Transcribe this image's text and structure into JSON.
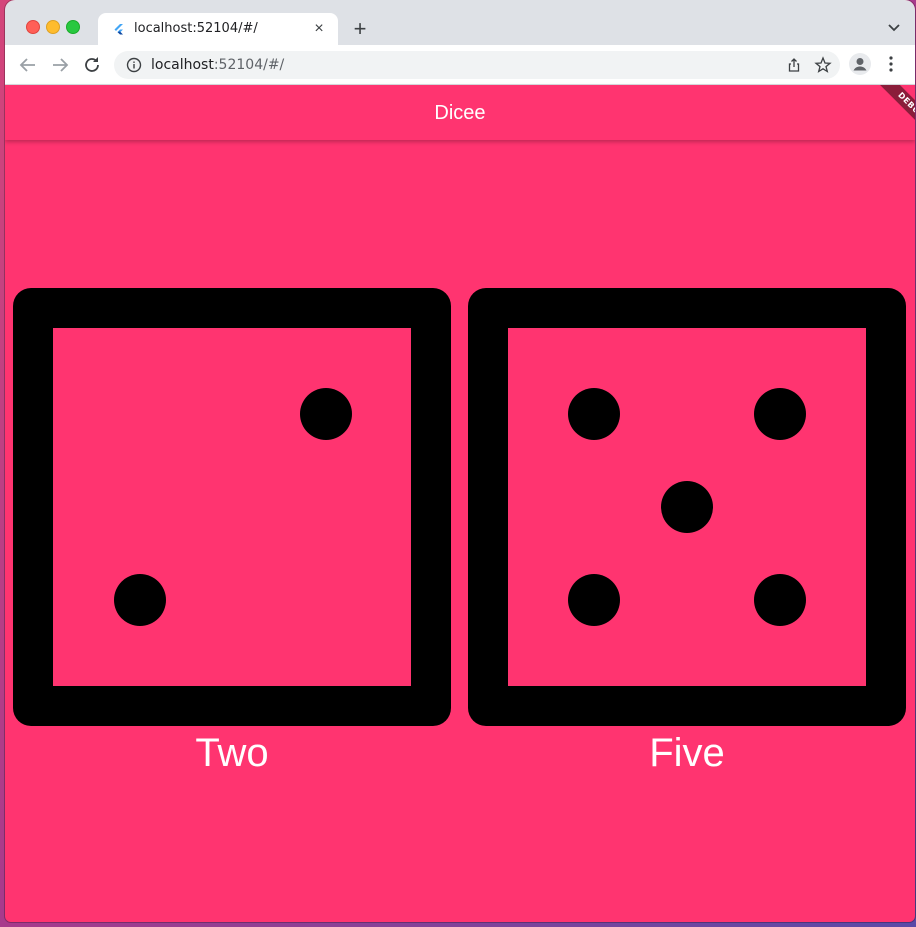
{
  "browser": {
    "tab_title": "localhost:52104/#/",
    "tab_close": "×",
    "new_tab": "+",
    "url_host": "localhost",
    "url_rest": ":52104/#/"
  },
  "app": {
    "title": "Dicee",
    "debug_banner": "DEBUG",
    "background_color": "#ff3470",
    "dice": [
      {
        "label": "Two",
        "value": 2
      },
      {
        "label": "Five",
        "value": 5
      }
    ]
  }
}
